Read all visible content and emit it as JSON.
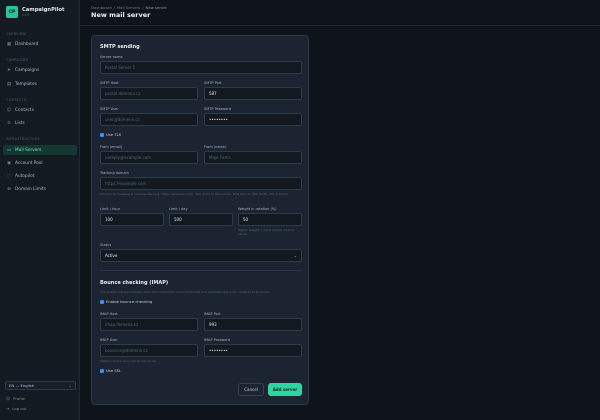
{
  "app": {
    "logo": "CP",
    "name": "CampaignPilot",
    "version": "v1.0"
  },
  "sidebar": {
    "sections": {
      "overview": "OVERVIEW",
      "campaigns": "CAMPAIGNS",
      "contacts": "CONTACTS",
      "infrastructure": "INFRASTRUCTURE"
    },
    "items": [
      {
        "label": "Dashboard",
        "icon": "grid-icon"
      },
      {
        "label": "Campaigns",
        "icon": "send-icon"
      },
      {
        "label": "Templates",
        "icon": "template-icon"
      },
      {
        "label": "Contacts",
        "icon": "user-icon"
      },
      {
        "label": "Lists",
        "icon": "list-icon"
      },
      {
        "label": "Mail Servers",
        "icon": "server-icon",
        "active": true
      },
      {
        "label": "Account Pool",
        "icon": "pool-icon"
      },
      {
        "label": "Autopilot",
        "icon": "autopilot-icon"
      },
      {
        "label": "Domain Limits",
        "icon": "domain-icon"
      }
    ],
    "language": "EN — English",
    "profile": "Profile",
    "logout": "Log out"
  },
  "header": {
    "breadcrumb": [
      "Dashboard",
      "/",
      "Mail Servers",
      "/",
      "New server"
    ],
    "title": "New mail server"
  },
  "smtp": {
    "heading": "SMTP sending",
    "server_name": {
      "label": "Server name",
      "placeholder": "Postal Server 1"
    },
    "host": {
      "label": "SMTP Host",
      "placeholder": "postal.domena.cz"
    },
    "port": {
      "label": "SMTP Port",
      "value": "587"
    },
    "user": {
      "label": "SMTP User",
      "placeholder": "user@domena.cz"
    },
    "password": {
      "label": "SMTP Password",
      "value": "••••••••"
    },
    "use_tls": "Use TLS",
    "from_email": {
      "label": "From (email)",
      "placeholder": "noreply@example.com"
    },
    "from_name": {
      "label": "From (name)",
      "placeholder": "Moje Firma"
    },
    "tracking": {
      "label": "Tracking domain",
      "placeholder": "https://example.com",
      "hint": "Domain for tracking & unsubscribe (e.g. https://example.com). Your point to this server. Falls back to APP_BASE_URL if empty."
    },
    "limit_hour": {
      "label": "Limit / hour",
      "value": "100"
    },
    "limit_day": {
      "label": "Limit / day",
      "value": "500"
    },
    "weight": {
      "label": "Weight in rotation (%)",
      "value": "50",
      "hint": "Higher weight = more emails via this server"
    },
    "status": {
      "label": "Status",
      "value": "Active"
    }
  },
  "bounce": {
    "heading": "Bounce checking (IMAP)",
    "description": "The system will periodically check this mailbox for bounced emails and automatically mark contacts as bounced.",
    "enable": "Enable bounce checking",
    "host": {
      "label": "IMAP Host",
      "placeholder": "imap.domena.cz"
    },
    "port": {
      "label": "IMAP Port",
      "value": "993"
    },
    "user": {
      "label": "IMAP User",
      "placeholder": "bounces@domena.cz"
    },
    "password": {
      "label": "IMAP Password",
      "value": "••••••••"
    },
    "user_hint": "Mailbox where bounced emails arrive",
    "use_ssl": "Use SSL"
  },
  "actions": {
    "cancel": "Cancel",
    "submit": "Add server"
  },
  "colors": {
    "accent": "#2fd3a1",
    "checkbox": "#3b82f6",
    "background": "#0f141b",
    "card": "#1b2430"
  }
}
